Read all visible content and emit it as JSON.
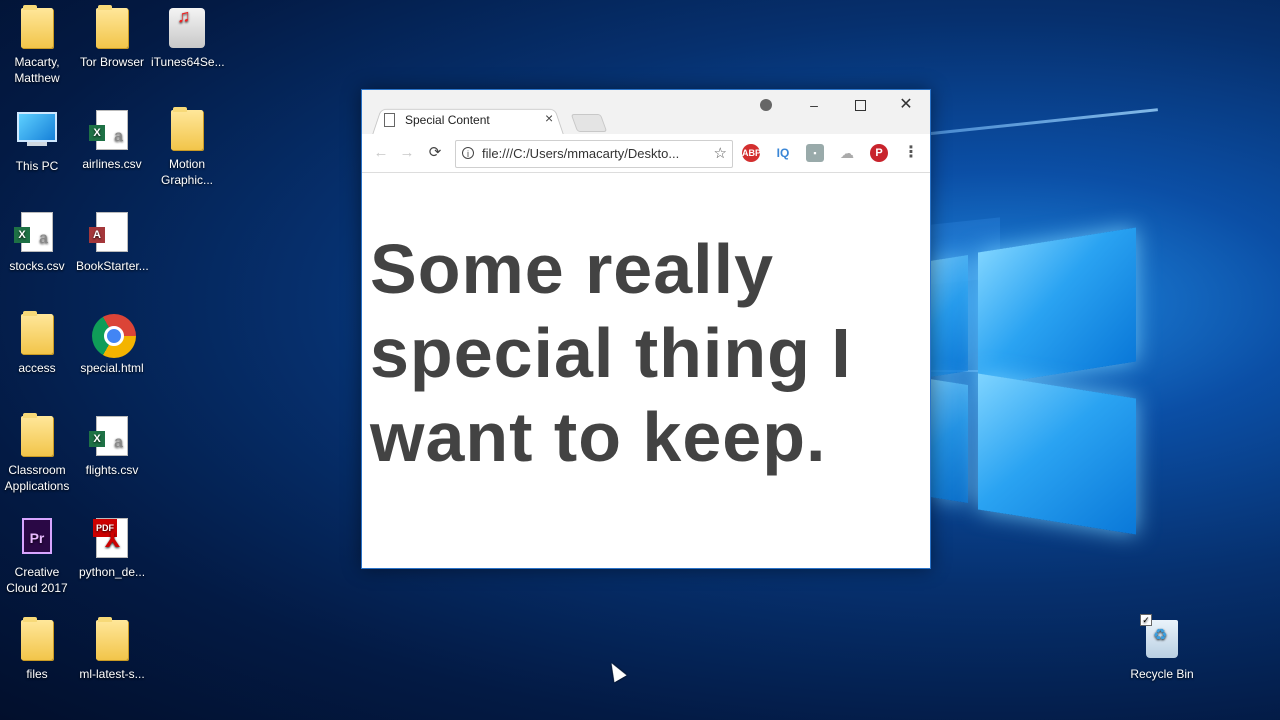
{
  "desktop": {
    "icons": [
      {
        "label": "Macarty, Matthew"
      },
      {
        "label": "Tor Browser"
      },
      {
        "label": "iTunes64Se..."
      },
      {
        "label": "This PC"
      },
      {
        "label": "airlines.csv"
      },
      {
        "label": "Motion Graphic..."
      },
      {
        "label": "stocks.csv"
      },
      {
        "label": "BookStarter..."
      },
      {
        "label": "access"
      },
      {
        "label": "special.html"
      },
      {
        "label": "Classroom Applications"
      },
      {
        "label": "flights.csv"
      },
      {
        "label": "Creative Cloud 2017"
      },
      {
        "label": "python_de..."
      },
      {
        "label": "files"
      },
      {
        "label": "ml-latest-s..."
      },
      {
        "label": "Recycle Bin"
      }
    ],
    "accent": "#0a78d8"
  },
  "browser": {
    "tab": {
      "title": "Special Content",
      "close": "×"
    },
    "window_controls": {
      "user": "",
      "minimize": "–",
      "maximize": "",
      "close": "✕"
    },
    "nav": {
      "back": "←",
      "forward": "→",
      "reload": "⟳"
    },
    "omnibox": {
      "info": "i",
      "url": "file:///C:/Users/mmacarty/Deskto...",
      "star": "☆"
    },
    "extensions": {
      "abp": "ABP",
      "iq": "IQ",
      "ext3": "▪",
      "ext4": "☁",
      "pinterest": "P",
      "menu": "⋮"
    },
    "content": {
      "text": "Some really special thing I want to keep."
    }
  }
}
